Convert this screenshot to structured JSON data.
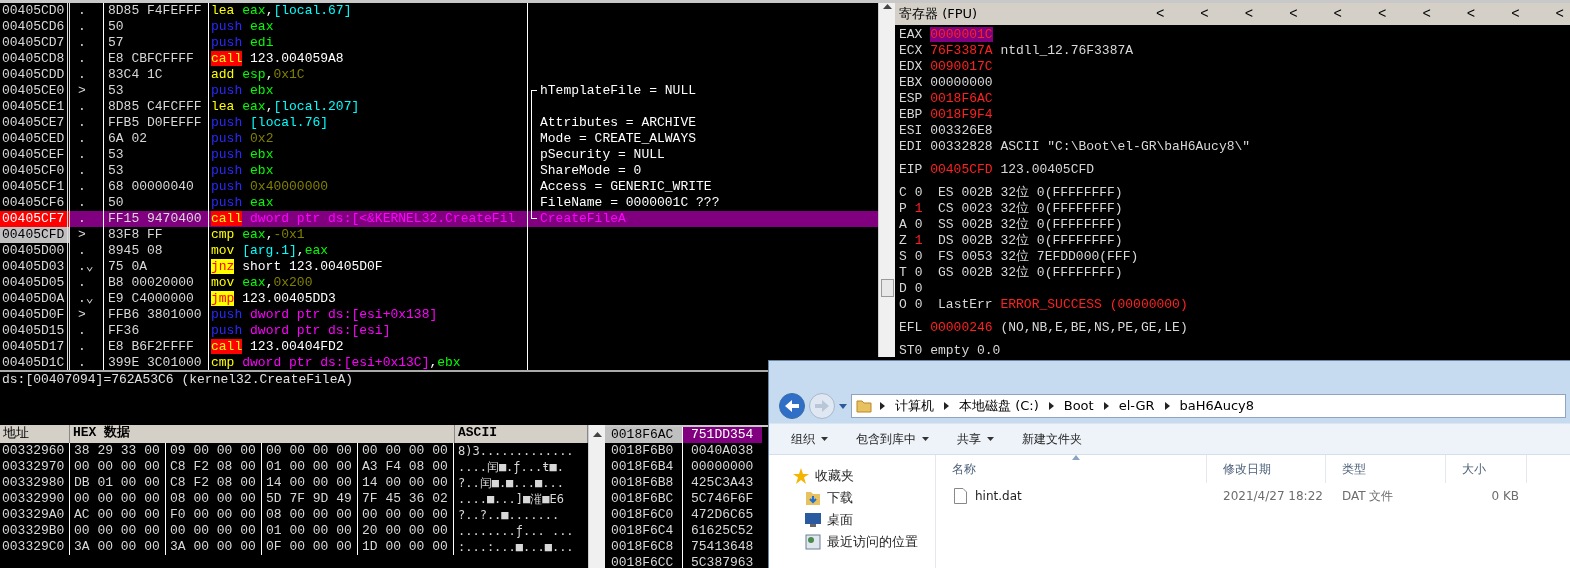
{
  "disasm": {
    "rows": [
      {
        "address": "00405CD0",
        "marker": ".",
        "bytes": "8D85 F4FEFFF",
        "mnemonic": "lea",
        "kind": "move",
        "operands": [
          {
            "text": "eax",
            "kind": "reg"
          },
          {
            "text": ",",
            "kind": "plain"
          },
          {
            "text": "[local.67]",
            "kind": "mem"
          }
        ],
        "breakpoint": false,
        "current": false,
        "selected": false
      },
      {
        "address": "00405CD6",
        "marker": ".",
        "bytes": "50",
        "mnemonic": "push",
        "kind": "stack",
        "operands": [
          {
            "text": "eax",
            "kind": "reg"
          }
        ],
        "breakpoint": false,
        "current": false,
        "selected": false
      },
      {
        "address": "00405CD7",
        "marker": ".",
        "bytes": "57",
        "mnemonic": "push",
        "kind": "stack",
        "operands": [
          {
            "text": "edi",
            "kind": "reg"
          }
        ],
        "breakpoint": false,
        "current": false,
        "selected": false
      },
      {
        "address": "00405CD8",
        "marker": ".",
        "bytes": "E8 CBFCFFFF",
        "mnemonic": "call",
        "kind": "call",
        "operands": [
          {
            "text": "123.004059A8",
            "kind": "addr"
          }
        ],
        "breakpoint": false,
        "current": false,
        "selected": false
      },
      {
        "address": "00405CDD",
        "marker": ".",
        "bytes": "83C4 1C",
        "mnemonic": "add",
        "kind": "move",
        "operands": [
          {
            "text": "esp",
            "kind": "reg"
          },
          {
            "text": ",",
            "kind": "plain"
          },
          {
            "text": "0x1C",
            "kind": "const"
          }
        ],
        "breakpoint": false,
        "current": false,
        "selected": false
      },
      {
        "address": "00405CE0",
        "marker": ">",
        "bytes": "53",
        "mnemonic": "push",
        "kind": "stack",
        "operands": [
          {
            "text": "ebx",
            "kind": "reg"
          }
        ],
        "comment": "hTemplateFile = NULL",
        "bracketed": true,
        "breakpoint": false,
        "current": false,
        "selected": false
      },
      {
        "address": "00405CE1",
        "marker": ".",
        "bytes": "8D85 C4FCFFF",
        "mnemonic": "lea",
        "kind": "move",
        "operands": [
          {
            "text": "eax",
            "kind": "reg"
          },
          {
            "text": ",",
            "kind": "plain"
          },
          {
            "text": "[local.207]",
            "kind": "mem"
          }
        ],
        "bracketed": true,
        "breakpoint": false,
        "current": false,
        "selected": false
      },
      {
        "address": "00405CE7",
        "marker": ".",
        "bytes": "FFB5 D0FEFFF",
        "mnemonic": "push",
        "kind": "stack",
        "operands": [
          {
            "text": "[local.76]",
            "kind": "mem"
          }
        ],
        "comment": "Attributes = ARCHIVE",
        "bracketed": true,
        "breakpoint": false,
        "current": false,
        "selected": false
      },
      {
        "address": "00405CED",
        "marker": ".",
        "bytes": "6A 02",
        "mnemonic": "push",
        "kind": "stack",
        "operands": [
          {
            "text": "0x2",
            "kind": "const"
          }
        ],
        "comment": "Mode = CREATE_ALWAYS",
        "bracketed": true,
        "breakpoint": false,
        "current": false,
        "selected": false
      },
      {
        "address": "00405CEF",
        "marker": ".",
        "bytes": "53",
        "mnemonic": "push",
        "kind": "stack",
        "operands": [
          {
            "text": "ebx",
            "kind": "reg"
          }
        ],
        "comment": "pSecurity = NULL",
        "bracketed": true,
        "breakpoint": false,
        "current": false,
        "selected": false
      },
      {
        "address": "00405CF0",
        "marker": ".",
        "bytes": "53",
        "mnemonic": "push",
        "kind": "stack",
        "operands": [
          {
            "text": "ebx",
            "kind": "reg"
          }
        ],
        "comment": "ShareMode = 0",
        "bracketed": true,
        "breakpoint": false,
        "current": false,
        "selected": false
      },
      {
        "address": "00405CF1",
        "marker": ".",
        "bytes": "68 00000040",
        "mnemonic": "push",
        "kind": "stack",
        "operands": [
          {
            "text": "0x40000000",
            "kind": "const"
          }
        ],
        "comment": "Access = GENERIC_WRITE",
        "bracketed": true,
        "breakpoint": false,
        "current": false,
        "selected": false
      },
      {
        "address": "00405CF6",
        "marker": ".",
        "bytes": "50",
        "mnemonic": "push",
        "kind": "stack",
        "operands": [
          {
            "text": "eax",
            "kind": "reg"
          }
        ],
        "comment": "FileName = 0000001C ???",
        "bracketed": true,
        "breakpoint": false,
        "current": false,
        "selected": false
      },
      {
        "address": "00405CF7",
        "marker": ".",
        "bytes": "FF15 9470400",
        "mnemonic": "call",
        "kind": "call",
        "operands": [
          {
            "text": "dword ptr ds:[<&KERNEL32.CreateFil",
            "kind": "ptr"
          }
        ],
        "comment": "CreateFileA",
        "bracketed": true,
        "breakpoint": true,
        "current": false,
        "selected": true
      },
      {
        "address": "00405CFD",
        "marker": ">",
        "bytes": "83F8 FF",
        "mnemonic": "cmp",
        "kind": "move",
        "operands": [
          {
            "text": "eax",
            "kind": "reg"
          },
          {
            "text": ",",
            "kind": "plain"
          },
          {
            "text": "-0x1",
            "kind": "const"
          }
        ],
        "breakpoint": false,
        "current": true,
        "selected": false
      },
      {
        "address": "00405D00",
        "marker": ".",
        "bytes": "8945 08",
        "mnemonic": "mov",
        "kind": "move",
        "operands": [
          {
            "text": "[arg.1]",
            "kind": "mem"
          },
          {
            "text": ",",
            "kind": "plain"
          },
          {
            "text": "eax",
            "kind": "reg"
          }
        ],
        "breakpoint": false,
        "current": false,
        "selected": false
      },
      {
        "address": "00405D03",
        "marker": ".⌄",
        "bytes": "75 0A",
        "mnemonic": "jnz",
        "kind": "jump",
        "operands": [
          {
            "text": "short 123.00405D0F",
            "kind": "addr"
          }
        ],
        "breakpoint": false,
        "current": false,
        "selected": false
      },
      {
        "address": "00405D05",
        "marker": ".",
        "bytes": "B8 00020000",
        "mnemonic": "mov",
        "kind": "move",
        "operands": [
          {
            "text": "eax",
            "kind": "reg"
          },
          {
            "text": ",",
            "kind": "plain"
          },
          {
            "text": "0x200",
            "kind": "const"
          }
        ],
        "breakpoint": false,
        "current": false,
        "selected": false
      },
      {
        "address": "00405D0A",
        "marker": ".⌄",
        "bytes": "E9 C4000000",
        "mnemonic": "jmp",
        "kind": "jump",
        "operands": [
          {
            "text": "123.00405DD3",
            "kind": "addr"
          }
        ],
        "breakpoint": false,
        "current": false,
        "selected": false
      },
      {
        "address": "00405D0F",
        "marker": ">",
        "bytes": "FFB6 3801000",
        "mnemonic": "push",
        "kind": "stack",
        "operands": [
          {
            "text": "dword ptr ds:[esi+0x138]",
            "kind": "ptr"
          }
        ],
        "breakpoint": false,
        "current": false,
        "selected": false
      },
      {
        "address": "00405D15",
        "marker": ".",
        "bytes": "FF36",
        "mnemonic": "push",
        "kind": "stack",
        "operands": [
          {
            "text": "dword ptr ds:[esi]",
            "kind": "ptr"
          }
        ],
        "breakpoint": false,
        "current": false,
        "selected": false
      },
      {
        "address": "00405D17",
        "marker": ".",
        "bytes": "E8 B6F2FFFF",
        "mnemonic": "call",
        "kind": "call",
        "operands": [
          {
            "text": "123.00404FD2",
            "kind": "addr"
          }
        ],
        "breakpoint": false,
        "current": false,
        "selected": false
      },
      {
        "address": "00405D1C",
        "marker": ".",
        "bytes": "399E 3C01000",
        "mnemonic": "cmp",
        "kind": "move",
        "operands": [
          {
            "text": "dword ptr ds:[esi+0x13C]",
            "kind": "ptr"
          },
          {
            "text": ",",
            "kind": "plain"
          },
          {
            "text": "ebx",
            "kind": "reg"
          }
        ],
        "breakpoint": false,
        "current": false,
        "selected": false
      }
    ]
  },
  "info_line": "ds:[00407094]=762A53C6 (kernel32.CreateFileA)",
  "registers": {
    "title": "寄存器 (FPU)",
    "arrows": [
      "<",
      "<",
      "<",
      "<",
      "<",
      "<",
      "<",
      "<",
      "<",
      "<"
    ],
    "general": [
      {
        "name": "EAX",
        "value": "0000001C",
        "changed": true,
        "selected": true
      },
      {
        "name": "ECX",
        "value": "76F3387A",
        "changed": true,
        "selected": false,
        "note": "ntdll_12.76F3387A"
      },
      {
        "name": "EDX",
        "value": "0090017C",
        "changed": true,
        "selected": false
      },
      {
        "name": "EBX",
        "value": "00000000",
        "changed": false,
        "selected": false
      },
      {
        "name": "ESP",
        "value": "0018F6AC",
        "changed": true,
        "selected": false
      },
      {
        "name": "EBP",
        "value": "0018F9F4",
        "changed": true,
        "selected": false
      },
      {
        "name": "ESI",
        "value": "003326E8",
        "changed": false,
        "selected": false
      },
      {
        "name": "EDI",
        "value": "00332828",
        "changed": false,
        "selected": false,
        "note": "ASCII \"C:\\Boot\\el-GR\\baH6Aucy8\\\""
      }
    ],
    "eip": {
      "name": "EIP",
      "value": "00405CFD",
      "changed": true,
      "note": "123.00405CFD"
    },
    "flags": [
      {
        "flag": "C",
        "bit": "0",
        "changed": false,
        "detail": "ES 002B 32位 0(FFFFFFFF)"
      },
      {
        "flag": "P",
        "bit": "1",
        "changed": true,
        "detail": "CS 0023 32位 0(FFFFFFFF)"
      },
      {
        "flag": "A",
        "bit": "0",
        "changed": false,
        "detail": "SS 002B 32位 0(FFFFFFFF)"
      },
      {
        "flag": "Z",
        "bit": "1",
        "changed": true,
        "detail": "DS 002B 32位 0(FFFFFFFF)"
      },
      {
        "flag": "S",
        "bit": "0",
        "changed": false,
        "detail": "FS 0053 32位 7EFDD000(FFF)"
      },
      {
        "flag": "T",
        "bit": "0",
        "changed": false,
        "detail": "GS 002B 32位 0(FFFFFFFF)"
      },
      {
        "flag": "D",
        "bit": "0",
        "changed": false
      },
      {
        "flag": "O",
        "bit": "0",
        "changed": false,
        "detail": "LastErr",
        "error": "ERROR_SUCCESS (00000000)"
      }
    ],
    "efl": {
      "name": "EFL",
      "value": "00000246",
      "changed": true,
      "note": "(NO,NB,E,BE,NS,PE,GE,LE)"
    },
    "st0": "ST0 empty 0.0"
  },
  "dump": {
    "columns": [
      "地址",
      "HEX 数据",
      "ASCII"
    ],
    "rows": [
      {
        "address": "00332960",
        "groups": [
          "38 29 33 00",
          "09 00 00 00",
          "00 00 00 00",
          "00 00 00 00"
        ],
        "ascii": "8)3............."
      },
      {
        "address": "00332970",
        "groups": [
          "00 00 00 00",
          "C8 F2 08 00",
          "01 00 00 00",
          "A3 F4 08 00"
        ],
        "ascii": "....闰■.ƒ...ŧ■."
      },
      {
        "address": "00332980",
        "groups": [
          "DB 01 00 00",
          "C8 F2 08 00",
          "14 00 00 00",
          "14 00 00 00"
        ],
        "ascii": "?..闰■.■...■..."
      },
      {
        "address": "00332990",
        "groups": [
          "00 00 00 00",
          "08 00 00 00",
          "5D 7F 9D 49",
          "7F 45 36 02"
        ],
        "ascii": "....■...]■漼■E6"
      },
      {
        "address": "003329A0",
        "groups": [
          "AC 00 00 00",
          "F0 00 00 00",
          "08 00 00 00",
          "00 00 00 00"
        ],
        "ascii": "?..?..■......."
      },
      {
        "address": "003329B0",
        "groups": [
          "00 00 00 00",
          "00 00 00 00",
          "01 00 00 00",
          "20 00 00 00"
        ],
        "ascii": "........ƒ... ..."
      },
      {
        "address": "003329C0",
        "groups": [
          "3A 00 00 00",
          "3A 00 00 00",
          "0F 00 00 00",
          "1D 00 00 00"
        ],
        "ascii": ":...:...■...■..."
      }
    ]
  },
  "stack": {
    "rows": [
      {
        "address": "0018F6AC",
        "value": "751DD354",
        "selected": true
      },
      {
        "address": "0018F6B0",
        "value": "0040A038",
        "selected": false
      },
      {
        "address": "0018F6B4",
        "value": "00000000",
        "selected": false
      },
      {
        "address": "0018F6B8",
        "value": "425C3A43",
        "selected": false
      },
      {
        "address": "0018F6BC",
        "value": "5C746F6F",
        "selected": false
      },
      {
        "address": "0018F6C0",
        "value": "472D6C65",
        "selected": false
      },
      {
        "address": "0018F6C4",
        "value": "61625C52",
        "selected": false
      },
      {
        "address": "0018F6C8",
        "value": "75413648",
        "selected": false
      },
      {
        "address": "0018F6CC",
        "value": "5C387963",
        "selected": false
      }
    ]
  },
  "explorer": {
    "breadcrumb": [
      "计算机",
      "本地磁盘 (C:)",
      "Boot",
      "el-GR",
      "baH6Aucy8"
    ],
    "toolbar": [
      {
        "label": "组织",
        "dropdown": true
      },
      {
        "label": "包含到库中",
        "dropdown": true
      },
      {
        "label": "共享",
        "dropdown": true
      },
      {
        "label": "新建文件夹",
        "dropdown": false
      }
    ],
    "sidebar": [
      {
        "label": "收藏夹",
        "kind": "star"
      },
      {
        "label": "下载",
        "kind": "download"
      },
      {
        "label": "桌面",
        "kind": "desktop"
      },
      {
        "label": "最近访问的位置",
        "kind": "recent"
      }
    ],
    "columns": [
      "名称",
      "修改日期",
      "类型",
      "大小"
    ],
    "files": [
      {
        "name": "hint.dat",
        "modified": "2021/4/27 18:22",
        "type": "DAT 文件",
        "size": "0 KB"
      }
    ]
  }
}
